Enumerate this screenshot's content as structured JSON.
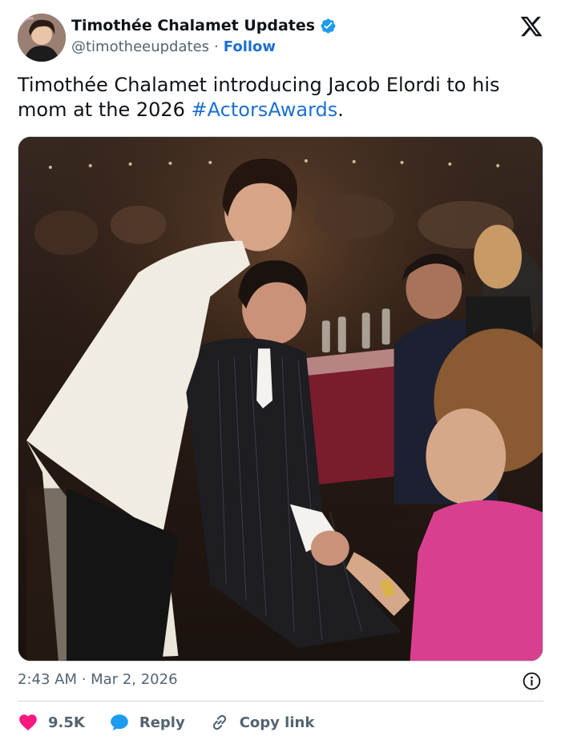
{
  "header": {
    "display_name": "Timothée Chalamet Updates",
    "handle": "@timotheeupdates",
    "separator": "·",
    "follow_label": "Follow"
  },
  "tweet": {
    "text_before": "Timothée Chalamet introducing Jacob Elordi to his mom at the 2026 ",
    "hashtag": "#ActorsAwards",
    "text_after": ".",
    "timestamp": "2:43 AM · Mar 2, 2026"
  },
  "actions": {
    "likes": "9.5K",
    "reply_label": "Reply",
    "copy_link_label": "Copy link"
  },
  "icons": {
    "verified": "verified-badge-icon",
    "x_logo": "x-logo-icon",
    "info": "info-icon",
    "like": "heart-icon",
    "reply": "speech-bubble-icon",
    "copy": "link-icon"
  },
  "colors": {
    "accent": "#1d6fd1",
    "like": "#f91880",
    "secondary_text": "#536471",
    "primary_text": "#0f1419"
  }
}
